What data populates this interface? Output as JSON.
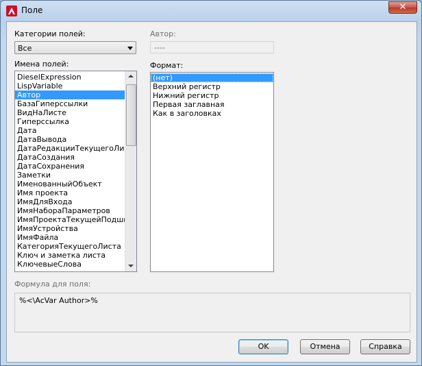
{
  "window": {
    "title": "Поле"
  },
  "categories": {
    "label": "Категории полей:",
    "selected": "Все"
  },
  "author": {
    "label": "Автор:",
    "value": "----"
  },
  "field_names": {
    "label": "Имена полей:",
    "items": [
      "DieselExpression",
      "LispVariable",
      "Автор",
      "БазаГиперссылки",
      "ВидНаЛисте",
      "Гиперссылка",
      "Дата",
      "ДатаВывода",
      "ДатаРедакцииТекущегоЛиста",
      "ДатаСоздания",
      "ДатаСохранения",
      "Заметки",
      "ИменованныйОбъект",
      "Имя проекта",
      "ИмяДляВхода",
      "ИмяНабораПараметров",
      "ИмяПроектаТекущейПодшивки",
      "ИмяУстройства",
      "ИмяФайла",
      "КатегорияТекущегоЛиста",
      "Ключ и заметка листа",
      "КлючевыеСлова"
    ],
    "selected_index": 2
  },
  "format": {
    "label": "Формат:",
    "items": [
      "(нет)",
      "Верхний регистр",
      "Нижний регистр",
      "Первая заглавная",
      "Как в заголовках"
    ],
    "selected_index": 0
  },
  "formula": {
    "label": "Формула для поля:",
    "value": "%<\\AcVar Author>%"
  },
  "buttons": {
    "ok": "OK",
    "cancel": "Отмена",
    "help": "Справка"
  }
}
